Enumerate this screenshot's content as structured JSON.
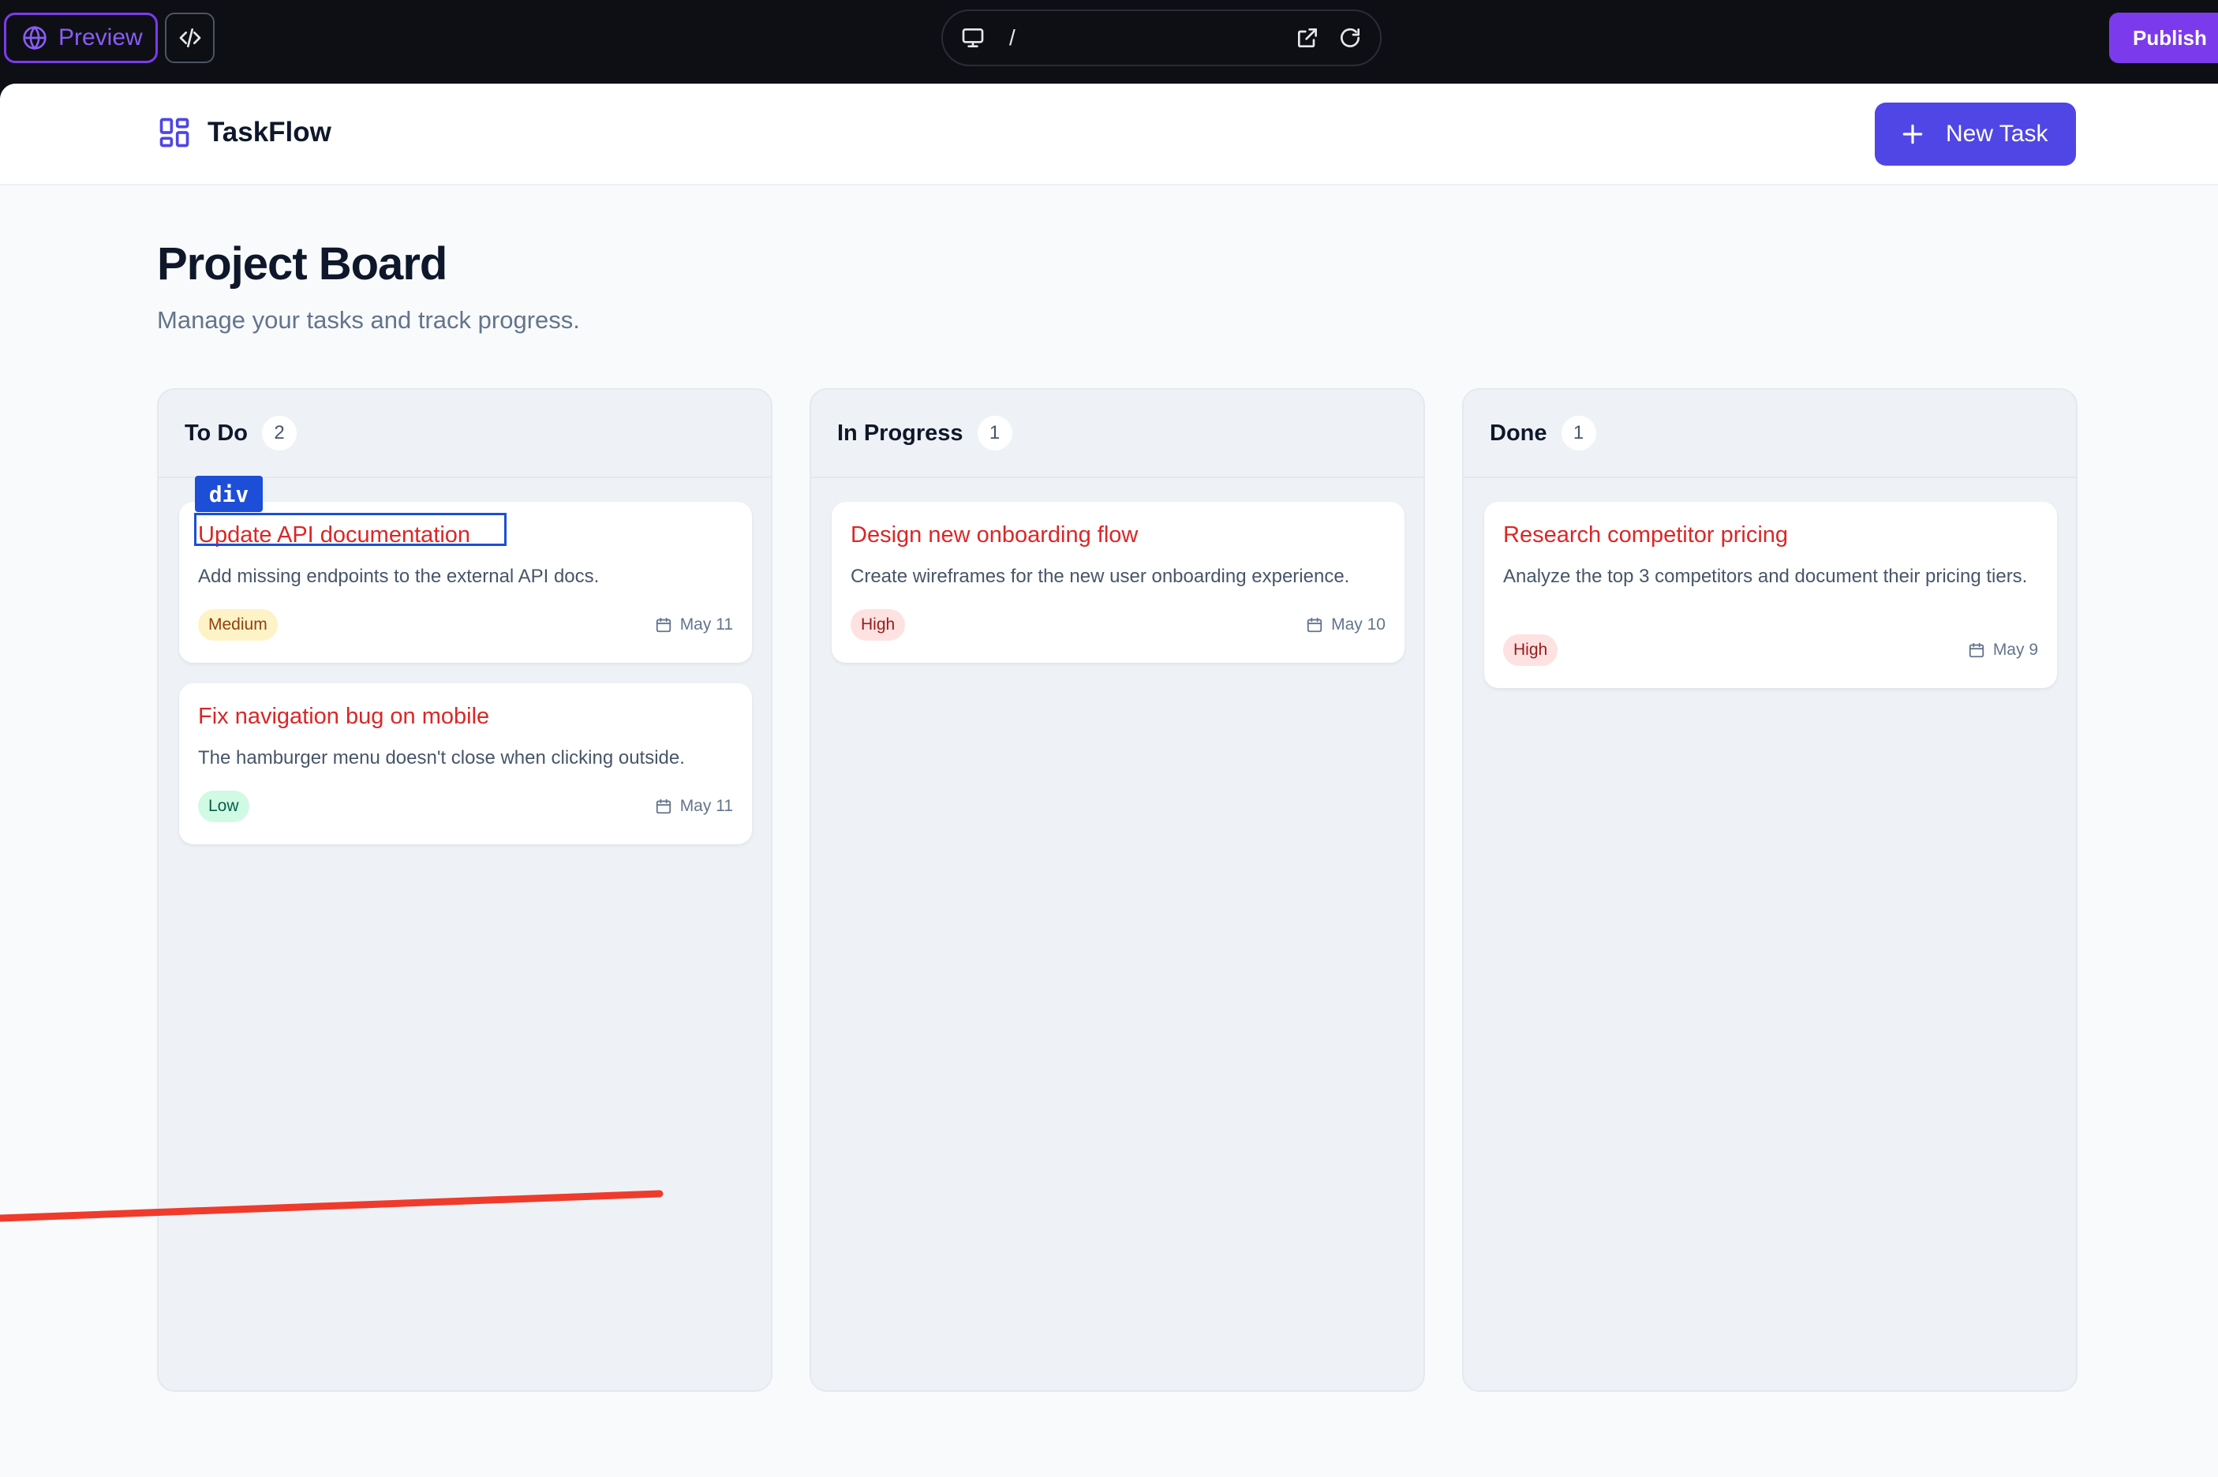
{
  "builder": {
    "preview_label": "Preview",
    "url_path": "/",
    "publish_label": "Publish"
  },
  "header": {
    "brand": "TaskFlow",
    "new_task_label": "New Task"
  },
  "page": {
    "title": "Project Board",
    "subtitle": "Manage your tasks and track progress."
  },
  "inspector": {
    "tag": "div"
  },
  "columns": [
    {
      "title": "To Do",
      "count": "2",
      "cards": [
        {
          "title": "Update API documentation",
          "description": "Add missing endpoints to the external API docs.",
          "priority": "Medium",
          "date": "May 11"
        },
        {
          "title": "Fix navigation bug on mobile",
          "description": "The hamburger menu doesn't close when clicking outside.",
          "priority": "Low",
          "date": "May 11"
        }
      ]
    },
    {
      "title": "In Progress",
      "count": "1",
      "cards": [
        {
          "title": "Design new onboarding flow",
          "description": "Create wireframes for the new user onboarding experience.",
          "priority": "High",
          "date": "May 10"
        }
      ]
    },
    {
      "title": "Done",
      "count": "1",
      "cards": [
        {
          "title": "Research competitor pricing",
          "description": "Analyze the top 3 competitors and document their pricing tiers.",
          "priority": "High",
          "date": "May 9"
        }
      ]
    }
  ],
  "colors": {
    "accent": "#4f46e5",
    "builder_accent": "#7c3aed",
    "card_title": "#dc2626",
    "annotation_line": "#ef3b2c"
  },
  "icons": [
    "globe-icon",
    "code-icon",
    "monitor-icon",
    "external-link-icon",
    "refresh-icon",
    "layout-grid-icon",
    "plus-icon",
    "calendar-icon"
  ]
}
